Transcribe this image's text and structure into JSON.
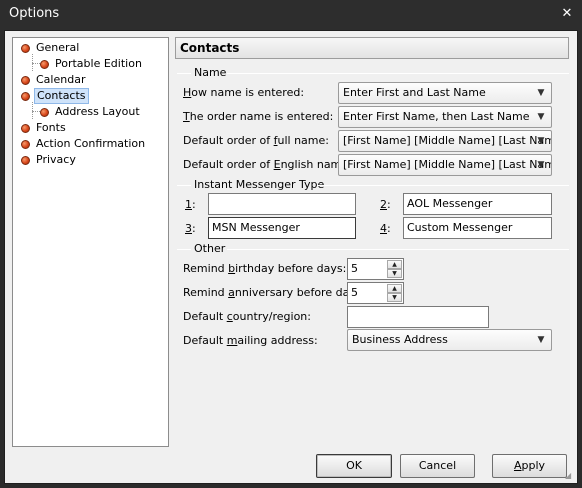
{
  "window": {
    "title": "Options",
    "close_glyph": "✕"
  },
  "tree": {
    "items": [
      {
        "label": "General"
      },
      {
        "label": "Portable Edition"
      },
      {
        "label": "Calendar"
      },
      {
        "label": "Contacts"
      },
      {
        "label": "Address Layout"
      },
      {
        "label": "Fonts"
      },
      {
        "label": "Action Confirmation"
      },
      {
        "label": "Privacy"
      }
    ]
  },
  "header": {
    "title": "Contacts"
  },
  "name_group": {
    "title": "Name",
    "how_entered": {
      "pre": "",
      "accel": "H",
      "post": "ow name is entered:",
      "value": "Enter First and Last Name"
    },
    "order_entered": {
      "pre": "",
      "accel": "T",
      "post": "he order name is entered:",
      "value": "Enter First Name, then Last Name"
    },
    "default_full": {
      "pre": "Default order of ",
      "accel": "f",
      "post": "ull name:",
      "value": "[First Name] [Middle Name] [Last Name]"
    },
    "default_english": {
      "pre": "Default order of ",
      "accel": "E",
      "post": "nglish name:",
      "value": "[First Name] [Middle Name] [Last Name]"
    }
  },
  "im_group": {
    "title": "Instant Messenger Type",
    "fields": [
      {
        "label": "1",
        "suffix": ":",
        "value": ""
      },
      {
        "label": "2",
        "suffix": ":",
        "value": "AOL Messenger"
      },
      {
        "label": "3",
        "suffix": ":",
        "value": "MSN Messenger"
      },
      {
        "label": "4",
        "suffix": ":",
        "value": "Custom Messenger"
      }
    ]
  },
  "other_group": {
    "title": "Other",
    "birthday": {
      "pre": "Remind ",
      "accel": "b",
      "post": "irthday before days:",
      "value": "5"
    },
    "anniversary": {
      "pre": "Remind ",
      "accel": "a",
      "post": "nniversary before days:",
      "value": "5"
    },
    "country": {
      "pre": "Default ",
      "accel": "c",
      "post": "ountry/region:",
      "value": ""
    },
    "mailing": {
      "pre": "Default ",
      "accel": "m",
      "post": "ailing address:",
      "value": "Business Address"
    }
  },
  "buttons": {
    "ok": "OK",
    "cancel": "Cancel",
    "apply_accel": "A",
    "apply_rest": "pply"
  },
  "icons": {
    "dropdown": "chevron-down-icon",
    "spin_up": "spin-up-icon",
    "spin_down": "spin-down-icon",
    "tree_bullet": "orange-bullet-icon"
  }
}
